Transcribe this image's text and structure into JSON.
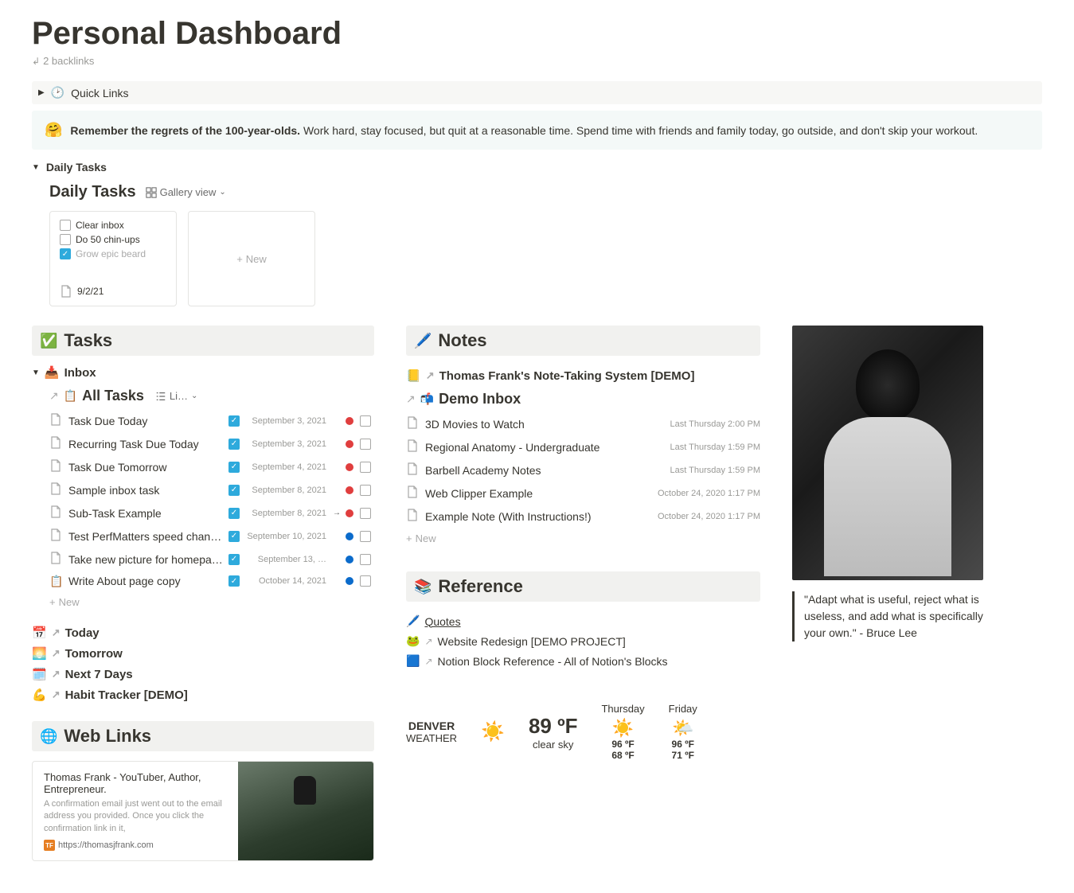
{
  "page": {
    "title": "Personal Dashboard",
    "backlinks": "2 backlinks"
  },
  "quick_links_toggle": {
    "label": "Quick Links"
  },
  "callout": {
    "emoji": "🤗",
    "bold": "Remember the regrets of the 100-year-olds.",
    "rest": " Work hard, stay focused, but quit at a reasonable time. Spend time with friends and family today, go outside, and don't skip your workout."
  },
  "daily_tasks": {
    "toggle_label": "Daily Tasks",
    "db_title": "Daily Tasks",
    "view_label": "Gallery view",
    "card": {
      "items": [
        {
          "label": "Clear inbox",
          "checked": false
        },
        {
          "label": "Do 50 chin-ups",
          "checked": false
        },
        {
          "label": "Grow epic beard",
          "checked": true
        }
      ],
      "date": "9/2/21"
    },
    "new_label": "New"
  },
  "tasks": {
    "heading": "Tasks",
    "inbox_label": "Inbox",
    "all_tasks_label": "All Tasks",
    "all_tasks_view": "Li…",
    "items": [
      {
        "name": "Task Due Today",
        "date": "September 3, 2021",
        "color": "red",
        "dep": false
      },
      {
        "name": "Recurring Task Due Today",
        "date": "September 3, 2021",
        "color": "red",
        "dep": false
      },
      {
        "name": "Task Due Tomorrow",
        "date": "September 4, 2021",
        "color": "red",
        "dep": false
      },
      {
        "name": "Sample inbox task",
        "date": "September 8, 2021",
        "color": "red",
        "dep": false
      },
      {
        "name": "Sub-Task Example",
        "date": "September 8, 2021",
        "color": "red",
        "dep": true
      },
      {
        "name": "Test PerfMatters speed changes",
        "date": "September 10, 2021",
        "color": "blue",
        "dep": false
      },
      {
        "name": "Take new picture for homepage bac…",
        "date": "September 13, …",
        "color": "blue",
        "dep": false
      },
      {
        "name": "Write About page copy",
        "date": "October 14, 2021",
        "color": "blue",
        "dep": false,
        "emoji": "📋"
      }
    ],
    "new_label": "New",
    "quick": [
      {
        "emoji": "📅",
        "label": "Today"
      },
      {
        "emoji": "🌅",
        "label": "Tomorrow"
      },
      {
        "emoji": "🗓️",
        "label": "Next 7 Days"
      },
      {
        "emoji": "💪",
        "label": "Habit Tracker [DEMO]"
      }
    ]
  },
  "web_links": {
    "heading": "Web Links",
    "bookmark": {
      "title": "Thomas Frank - YouTuber, Author, Entrepreneur.",
      "desc": "A confirmation email just went out to the email address you provided. Once you click the confirmation link in it,",
      "url": "https://thomasjfrank.com",
      "favicon": "TF"
    }
  },
  "notes": {
    "heading": "Notes",
    "system_link": "Thomas Frank's Note-Taking System [DEMO]",
    "demo_inbox": "Demo Inbox",
    "items": [
      {
        "name": "3D Movies to Watch",
        "date": "Last Thursday 2:00 PM"
      },
      {
        "name": "Regional Anatomy - Undergraduate",
        "date": "Last Thursday 1:59 PM"
      },
      {
        "name": "Barbell Academy Notes",
        "date": "Last Thursday 1:59 PM"
      },
      {
        "name": "Web Clipper Example",
        "date": "October 24, 2020 1:17 PM"
      },
      {
        "name": "Example Note (With Instructions!)",
        "date": "October 24, 2020 1:17 PM"
      }
    ],
    "new_label": "New"
  },
  "reference": {
    "heading": "Reference",
    "items": [
      {
        "emoji": "🖊️",
        "label": "Quotes",
        "underline": true
      },
      {
        "emoji": "🐸",
        "label": "Website Redesign [DEMO PROJECT]",
        "underline": false
      },
      {
        "emoji": "🟦",
        "label": "Notion Block Reference - All of Notion's Blocks",
        "underline": false
      }
    ]
  },
  "weather": {
    "city": "DENVER",
    "sub": "WEATHER",
    "now_temp": "89 ºF",
    "now_cond": "clear sky",
    "days": [
      {
        "name": "Thursday",
        "icon": "☀️",
        "hi": "96 ºF",
        "lo": "68 ºF"
      },
      {
        "name": "Friday",
        "icon": "🌤️",
        "hi": "96 ºF",
        "lo": "71 ºF"
      }
    ]
  },
  "quote": {
    "text": "\"Adapt what is useful, reject what is useless, and add what is specifically your own.\" - Bruce Lee"
  }
}
